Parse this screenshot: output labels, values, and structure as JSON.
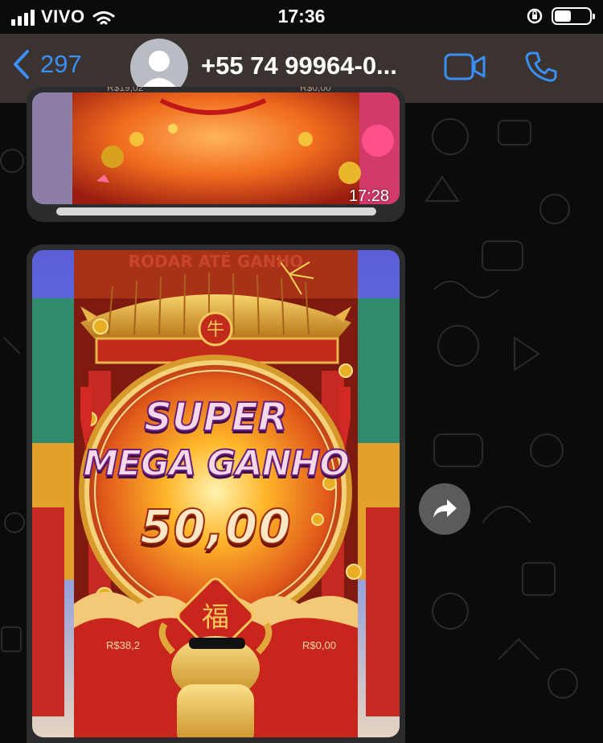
{
  "status_bar": {
    "carrier": "VIVO",
    "time": "17:36",
    "icons": [
      "signal-icon",
      "wifi-icon",
      "orientation-lock-icon",
      "battery-icon"
    ]
  },
  "header": {
    "back_count": "297",
    "contact_name": "+55 74 99964-0...",
    "icons": [
      "back-chevron-icon",
      "avatar-icon",
      "video-call-icon",
      "phone-icon"
    ]
  },
  "messages": [
    {
      "type": "video",
      "timestamp": "17:28",
      "overlay_text": {
        "left": "R$19,02",
        "right": "R$0,00"
      }
    },
    {
      "type": "video",
      "game_title": "RODAR ATÉ GANHO",
      "win_line1": "SUPER",
      "win_line2": "MEGA GANHO",
      "win_amount": "50,00",
      "balance_left": "R$38,2",
      "balance_right": "R$0,00"
    }
  ],
  "actions": {
    "forward_icon": "forward-icon"
  },
  "colors": {
    "accent": "#3a8ff7",
    "header_bg": "#3a3330",
    "bubble_bg": "#2c2c2e",
    "chat_bg": "#0b0b0b"
  }
}
